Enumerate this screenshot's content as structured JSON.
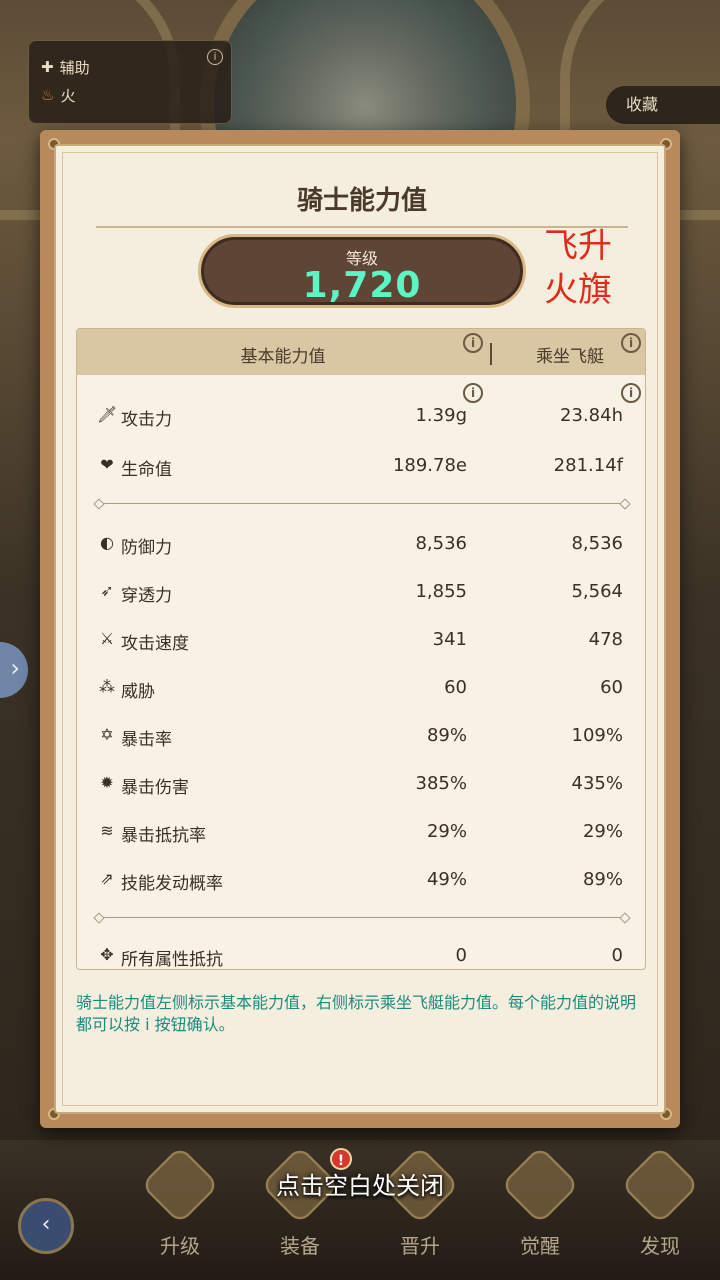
{
  "background": {
    "role_panel": {
      "role1": "辅助",
      "role2": "火",
      "info": "i"
    },
    "favorite_label": "收藏",
    "side_arrow": "›"
  },
  "modal": {
    "title": "骑士能力值",
    "level_label": "等级",
    "level_value": "1,720",
    "annotation_line1": "飞升",
    "annotation_line2": "火旗",
    "header": {
      "base": "基本能力值",
      "ship": "乘坐飞艇",
      "info": "i"
    },
    "stats_group1": [
      {
        "icon": "sword-icon",
        "glyph": "🗡",
        "name": "攻击力",
        "base": "1.39g",
        "ship": "23.84h"
      },
      {
        "icon": "heart-icon",
        "glyph": "❤",
        "name": "生命值",
        "base": "189.78e",
        "ship": "281.14f"
      }
    ],
    "stats_group2": [
      {
        "icon": "shield-icon",
        "glyph": "◐",
        "name": "防御力",
        "base": "8,536",
        "ship": "8,536"
      },
      {
        "icon": "pierce-icon",
        "glyph": "➶",
        "name": "穿透力",
        "base": "1,855",
        "ship": "5,564"
      },
      {
        "icon": "attack-speed-icon",
        "glyph": "⚔",
        "name": "攻击速度",
        "base": "341",
        "ship": "478"
      },
      {
        "icon": "threat-icon",
        "glyph": "⁂",
        "name": "威胁",
        "base": "60",
        "ship": "60"
      },
      {
        "icon": "crit-rate-icon",
        "glyph": "✡",
        "name": "暴击率",
        "base": "89%",
        "ship": "109%"
      },
      {
        "icon": "crit-damage-icon",
        "glyph": "✹",
        "name": "暴击伤害",
        "base": "385%",
        "ship": "435%"
      },
      {
        "icon": "crit-resist-icon",
        "glyph": "≋",
        "name": "暴击抵抗率",
        "base": "29%",
        "ship": "29%"
      },
      {
        "icon": "skill-proc-icon",
        "glyph": "⇗",
        "name": "技能发动概率",
        "base": "49%",
        "ship": "89%"
      }
    ],
    "stats_group3": [
      {
        "icon": "all-resist-icon",
        "glyph": "✥",
        "name": "所有属性抵抗",
        "base": "0",
        "ship": "0"
      }
    ],
    "description": "骑士能力值左侧标示基本能力值，右侧标示乘坐飞艇能力值。每个能力值的说明都可以按 i 按钮确认。"
  },
  "close_hint": "点击空白处关闭",
  "bottom_nav": {
    "back": "‹",
    "badge": "!",
    "items": [
      {
        "label": "升级"
      },
      {
        "label": "装备"
      },
      {
        "label": "晋升"
      },
      {
        "label": "觉醒"
      },
      {
        "label": "发现"
      }
    ]
  },
  "colors": {
    "level_value": "#5cf5c4",
    "annotation": "#e02b1b",
    "description": "#1c8a7e",
    "modal_frame": "#b88a5b"
  }
}
